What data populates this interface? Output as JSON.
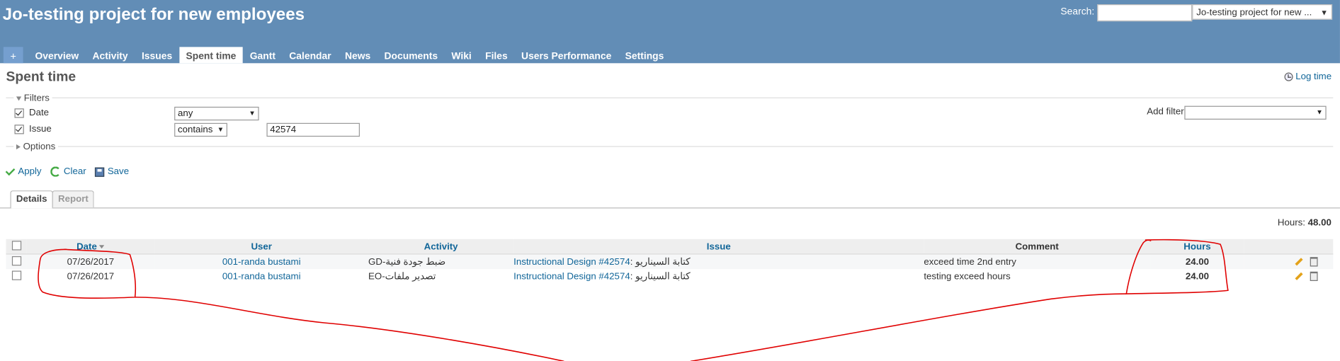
{
  "header": {
    "project_title": "Jo-testing project for new employees",
    "search_label": "Search:",
    "search_value": "",
    "project_jump": "Jo-testing project for new ..."
  },
  "menu": {
    "new_label": "+",
    "items": [
      "Overview",
      "Activity",
      "Issues",
      "Spent time",
      "Gantt",
      "Calendar",
      "News",
      "Documents",
      "Wiki",
      "Files",
      "Users Performance",
      "Settings"
    ],
    "selected": "Spent time"
  },
  "page": {
    "title": "Spent time",
    "log_time": "Log time"
  },
  "filters": {
    "legend": "Filters",
    "date": {
      "label": "Date",
      "checked": true,
      "operator": "any"
    },
    "issue": {
      "label": "Issue",
      "checked": true,
      "operator": "contains",
      "value": "42574"
    },
    "add_filter_label": "Add filter",
    "add_filter_value": ""
  },
  "options": {
    "legend": "Options"
  },
  "actions": {
    "apply": "Apply",
    "clear": "Clear",
    "save": "Save"
  },
  "tabs": {
    "details": "Details",
    "report": "Report",
    "selected": "Details"
  },
  "totals": {
    "label": "Hours:",
    "value": "48.00"
  },
  "table": {
    "columns": {
      "date": "Date",
      "user": "User",
      "activity": "Activity",
      "issue": "Issue",
      "comment": "Comment",
      "hours": "Hours"
    },
    "rows": [
      {
        "date": "07/26/2017",
        "user": "001-randa bustami",
        "activity": "GD-ضبط جودة فنية",
        "issue_link": "Instructional Design #42574",
        "issue_subject": ": كتابة السيناريو",
        "comment": "exceed time 2nd entry",
        "hours": "24.00"
      },
      {
        "date": "07/26/2017",
        "user": "001-randa bustami",
        "activity": "EO-تصدير ملفات",
        "issue_link": "Instructional Design #42574",
        "issue_subject": ": كتابة السيناريو",
        "comment": "testing exceed hours",
        "hours": "24.00"
      }
    ]
  },
  "colors": {
    "header_bg": "#628db6",
    "link": "#116699",
    "annotation": "#e00000"
  }
}
